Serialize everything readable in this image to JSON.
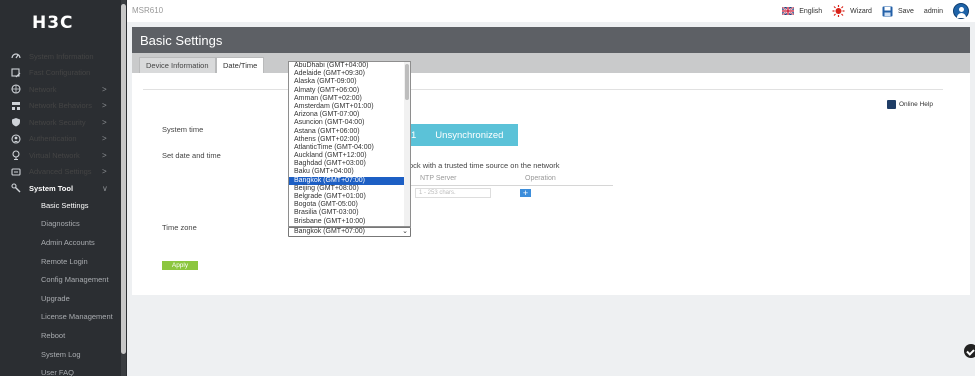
{
  "app": {
    "logo": "H3C",
    "device": "MSR610"
  },
  "topbar": {
    "language": "English",
    "wizard": "Wizard",
    "save": "Save",
    "user": "admin"
  },
  "sidebar": {
    "items": [
      {
        "label": "System Information",
        "icon": "gauge-icon",
        "chevron": ""
      },
      {
        "label": "Fast Configuration",
        "icon": "fast-config-icon",
        "chevron": ""
      },
      {
        "label": "Network",
        "icon": "globe-icon",
        "chevron": ">"
      },
      {
        "label": "Network Behaviors",
        "icon": "network-behaviors-icon",
        "chevron": ">"
      },
      {
        "label": "Network Security",
        "icon": "shield-icon",
        "chevron": ">"
      },
      {
        "label": "Authentication",
        "icon": "authentication-icon",
        "chevron": ">"
      },
      {
        "label": "Virtual Network",
        "icon": "virtual-network-icon",
        "chevron": ">"
      },
      {
        "label": "Advanced Settings",
        "icon": "advanced-settings-icon",
        "chevron": ">"
      },
      {
        "label": "System Tool",
        "icon": "system-tool-icon",
        "chevron": "∨"
      }
    ],
    "subitems": [
      "Basic Settings",
      "Diagnostics",
      "Admin Accounts",
      "Remote Login",
      "Config Management",
      "Upgrade",
      "License Management",
      "Reboot",
      "System Log",
      "User FAQ"
    ]
  },
  "page": {
    "title": "Basic Settings",
    "tabs": [
      "Device Information",
      "Date/Time"
    ],
    "online_help": "Online Help",
    "system_time_label": "System time",
    "set_date_label": "Set date and time",
    "sync_number": "1",
    "sync_status": "Unsynchronized",
    "sync_note": "ock with a trusted time source on the network",
    "ntp_header": "NTP Server",
    "operation_header": "Operation",
    "ntp_placeholder": "1 - 253 chars.",
    "add_label": "+",
    "timezone_label": "Time zone",
    "timezone_value": "Bangkok (GMT+07:00)",
    "apply_label": "Apply"
  },
  "timezone_options": [
    "AbuDhabi (GMT+04:00)",
    "Adelaide (GMT+09:30)",
    "Alaska (GMT-09:00)",
    "Almaty (GMT+06:00)",
    "Amman (GMT+02:00)",
    "Amsterdam (GMT+01:00)",
    "Arizona (GMT-07:00)",
    "Asuncion (GMT-04:00)",
    "Astana (GMT+06:00)",
    "Athens (GMT+02:00)",
    "AtlanticTime (GMT-04:00)",
    "Auckland (GMT+12:00)",
    "Baghdad (GMT+03:00)",
    "Baku (GMT+04:00)",
    "Bangkok (GMT+07:00)",
    "Beijing (GMT+08:00)",
    "Belgrade (GMT+01:00)",
    "Bogota (GMT-05:00)",
    "Brasilia (GMT-03:00)",
    "Brisbane (GMT+10:00)"
  ],
  "selected_timezone_index": 14,
  "colors": {
    "sidebar": "#2b2e32",
    "title_bar": "#5d6065",
    "sync": "#5bc2d8",
    "apply": "#8cc63f",
    "selection": "#1d5fc4"
  }
}
